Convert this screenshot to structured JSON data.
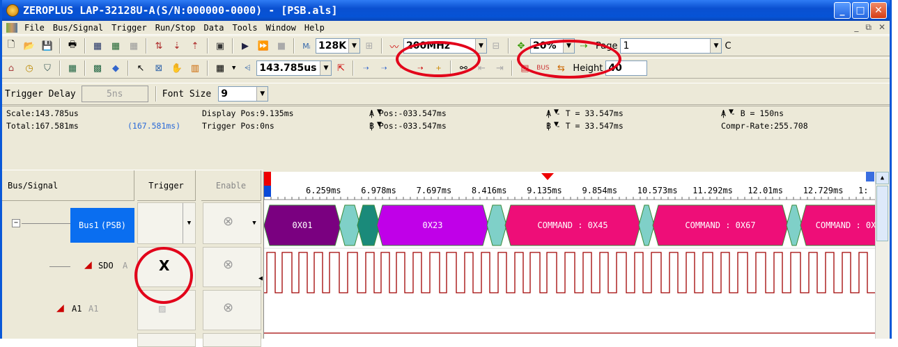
{
  "window": {
    "title": "ZEROPLUS LAP-32128U-A(S/N:000000-0000) - [PSB.als]"
  },
  "menu": [
    "File",
    "Bus/Signal",
    "Trigger",
    "Run/Stop",
    "Data",
    "Tools",
    "Window",
    "Help"
  ],
  "toolbar1": {
    "memory": "128K",
    "sample_rate": "200MHz",
    "zoom": "20%",
    "page_label": "Page",
    "page_value": "1",
    "cut_letter": "C"
  },
  "toolbar2": {
    "scale": "143.785us",
    "height_label": "Height",
    "height_value": "40"
  },
  "toolbar3": {
    "trigger_delay_label": "Trigger Delay",
    "trigger_delay_value": "5ns",
    "font_size_label": "Font Size",
    "font_size_value": "9"
  },
  "info": {
    "scale": "Scale:143.785us",
    "total": "Total:167.581ms",
    "total_paren": "(167.581ms)",
    "display_pos": "Display Pos:9.135ms",
    "trigger_pos": "Trigger Pos:0ns",
    "a_pos": "A Pos:-033.547ms",
    "b_pos": "B Pos:-033.547ms",
    "a_t": "A - T = 33.547ms",
    "b_t": "B - T = 33.547ms",
    "a_b": "A - B = 150ns",
    "compr_rate": "Compr-Rate:255.708"
  },
  "columns": {
    "bus_signal": "Bus/Signal",
    "trigger": "Trigger",
    "enable": "Enable"
  },
  "signals": [
    {
      "name": "Bus1",
      "suffix": "(PSB)"
    },
    {
      "name": "SDO",
      "suffix": "A"
    },
    {
      "name": "A1",
      "suffix": "A1"
    }
  ],
  "timeline": [
    "6.259ms",
    "6.978ms",
    "7.697ms",
    "8.416ms",
    "9.135ms",
    "9.854ms",
    "10.573ms",
    "11.292ms",
    "12.01ms",
    "12.729ms",
    "1:"
  ],
  "bus_segments": [
    "0X01",
    "0X23",
    "COMMAND : 0X45",
    "COMMAND : 0X67",
    "COMMAND : 0X"
  ],
  "colors": {
    "title_blue": "#0a50d0",
    "bus_purple": "#7a0080",
    "bus_magenta": "#c000e8",
    "bus_pink": "#ee0e78",
    "bus_teal": "#7fd0c8",
    "signal_red": "#a00000",
    "annotation_red": "#e2001a"
  }
}
